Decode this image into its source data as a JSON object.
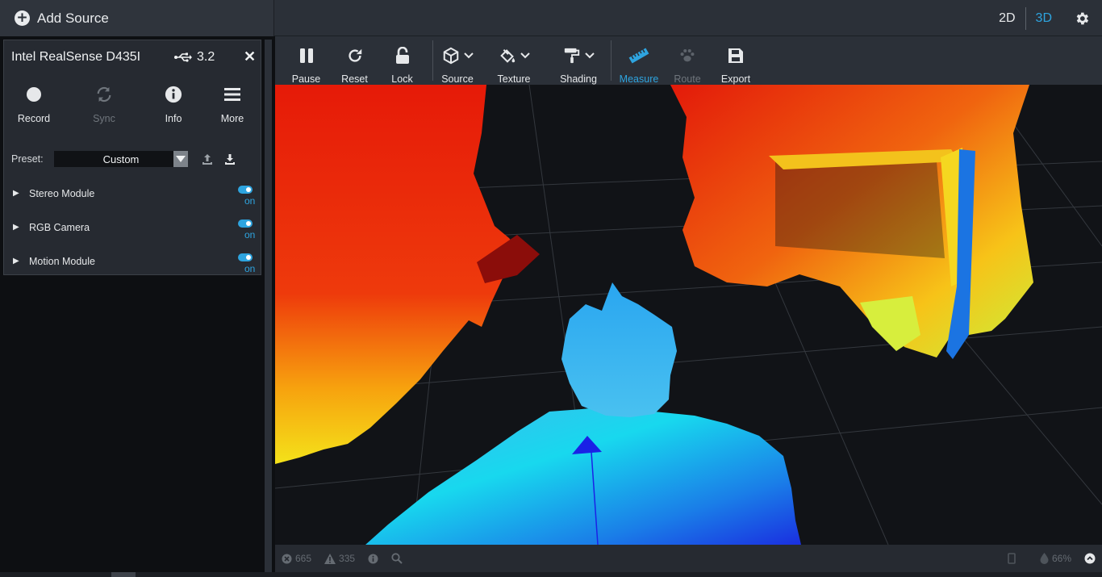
{
  "header": {
    "add_source_label": "Add Source",
    "view_2d": "2D",
    "view_3d": "3D",
    "active_view": "3D"
  },
  "device": {
    "name": "Intel RealSense D435I",
    "usb_version": "3.2",
    "actions": [
      {
        "label": "Record",
        "icon": "record-icon",
        "enabled": true
      },
      {
        "label": "Sync",
        "icon": "sync-icon",
        "enabled": false
      },
      {
        "label": "Info",
        "icon": "info-icon",
        "enabled": true
      },
      {
        "label": "More",
        "icon": "menu-icon",
        "enabled": true
      }
    ],
    "preset_label": "Preset:",
    "preset_value": "Custom",
    "modules": [
      {
        "name": "Stereo Module",
        "state": "on"
      },
      {
        "name": "RGB Camera",
        "state": "on"
      },
      {
        "name": "Motion Module",
        "state": "on"
      }
    ]
  },
  "toolbar": {
    "tools": [
      {
        "label": "Pause",
        "icon": "pause-icon"
      },
      {
        "label": "Reset",
        "icon": "reset-icon"
      },
      {
        "label": "Lock",
        "icon": "unlock-icon"
      },
      {
        "label": "Source",
        "icon": "cube-icon"
      },
      {
        "label": "Texture",
        "icon": "paint-bucket-icon"
      },
      {
        "label": "Shading",
        "icon": "paint-roller-icon"
      },
      {
        "label": "Measure",
        "icon": "ruler-icon"
      },
      {
        "label": "Route",
        "icon": "paw-icon"
      },
      {
        "label": "Export",
        "icon": "save-icon"
      }
    ],
    "accent": "#2ea4df"
  },
  "status": {
    "errors": "665",
    "warnings": "335",
    "fill_percent": "66%"
  }
}
